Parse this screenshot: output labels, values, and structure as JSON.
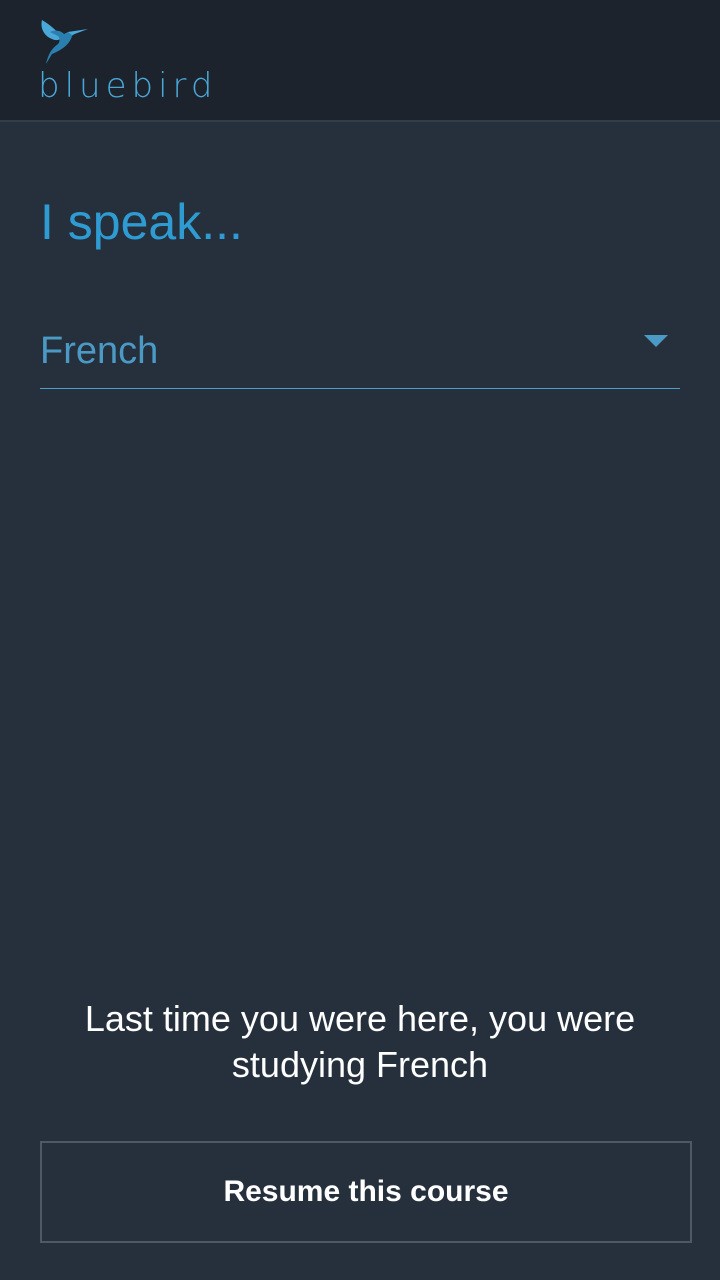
{
  "header": {
    "logo_text": "bluebird"
  },
  "main": {
    "title": "I speak...",
    "language_select": {
      "selected": "French"
    },
    "last_time_message": "Last time you were here, you were studying French",
    "resume_button_label": "Resume this course"
  },
  "colors": {
    "header_bg": "#1c232c",
    "screen_bg": "#25303c",
    "accent": "#2e9bd2",
    "select_text": "#4b9ac6",
    "button_border": "#4d5965"
  }
}
